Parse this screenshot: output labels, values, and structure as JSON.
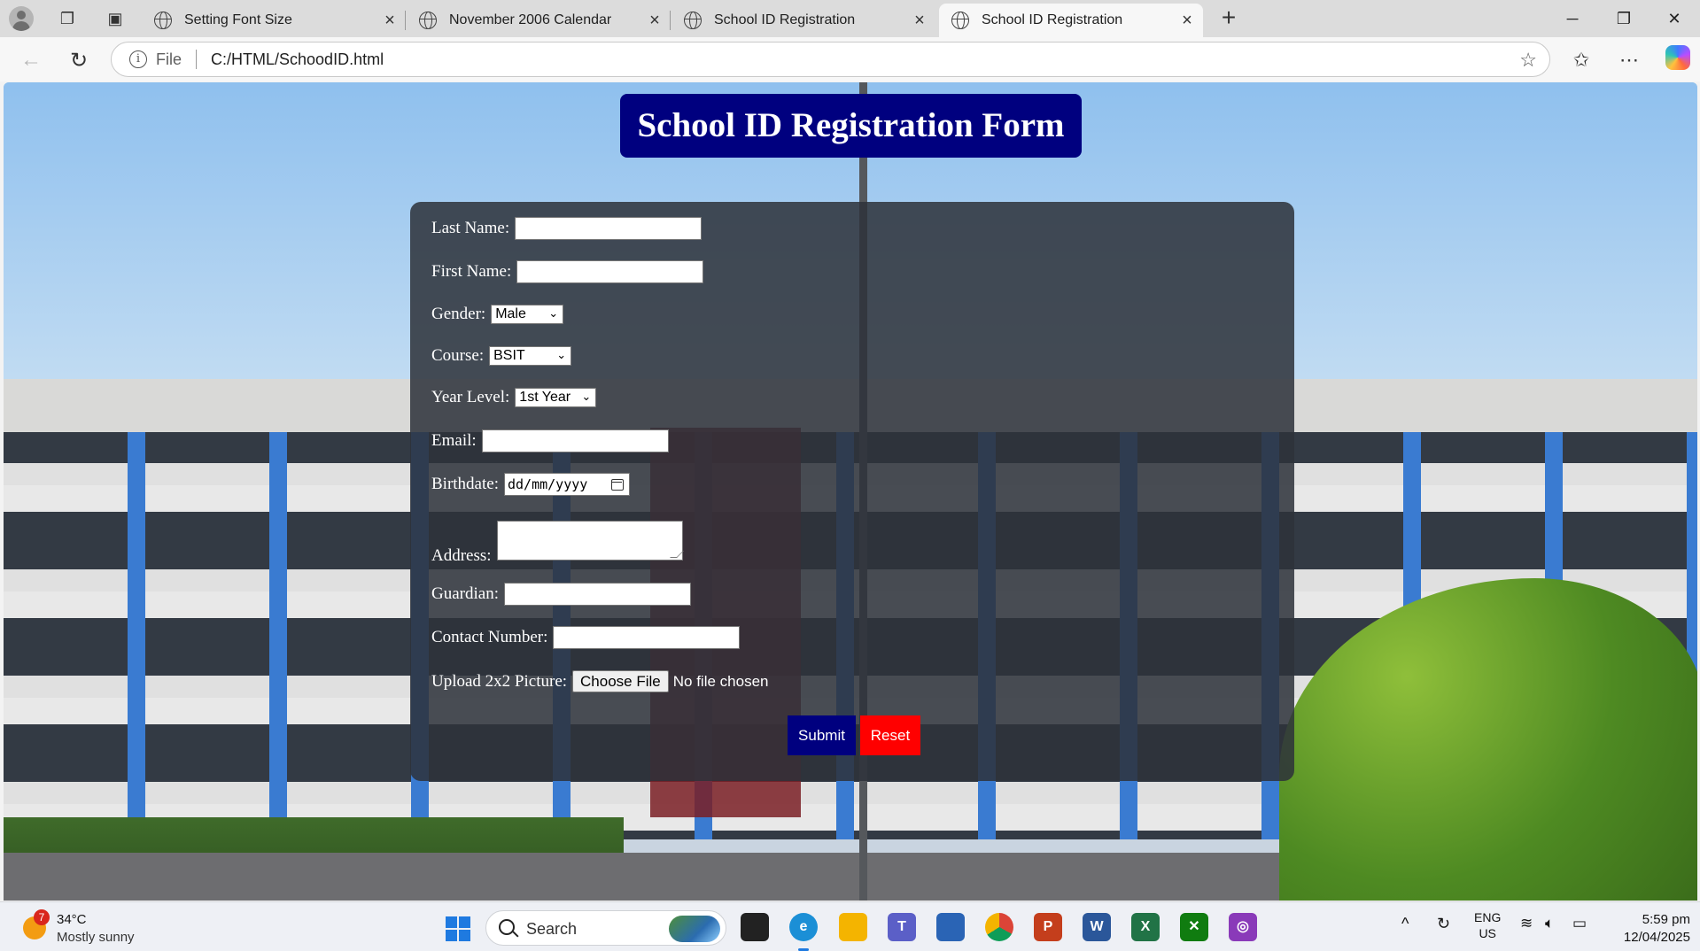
{
  "browser": {
    "tabs": [
      {
        "title": "Setting Font Size"
      },
      {
        "title": "November 2006 Calendar"
      },
      {
        "title": "School ID Registration"
      },
      {
        "title": "School ID Registration"
      }
    ],
    "address": {
      "scheme_label": "File",
      "url": "C:/HTML/SchoodID.html"
    }
  },
  "page": {
    "title": "School ID Registration Form",
    "form": {
      "last_name_label": "Last Name:",
      "first_name_label": "First Name:",
      "gender_label": "Gender:",
      "gender_value": "Male",
      "course_label": "Course:",
      "course_value": "BSIT",
      "year_level_label": "Year Level:",
      "year_level_value": "1st Year",
      "email_label": "Email:",
      "birthdate_label": "Birthdate:",
      "birthdate_placeholder": "dd/mm/yyyy",
      "address_label": "Address:",
      "guardian_label": "Guardian:",
      "contact_label": "Contact Number:",
      "upload_label": "Upload 2x2 Picture:",
      "choose_file_label": "Choose File",
      "no_file_text": "No file chosen",
      "submit_label": "Submit",
      "reset_label": "Reset"
    }
  },
  "taskbar": {
    "weather": {
      "badge": "7",
      "temp": "34°C",
      "condition": "Mostly sunny"
    },
    "search_label": "Search",
    "language": {
      "lang": "ENG",
      "region": "US"
    },
    "time": "5:59 pm",
    "date": "12/04/2025"
  },
  "colors": {
    "title_bg": "#00007f",
    "submit_bg": "#00007f",
    "reset_bg": "#ff0000"
  }
}
